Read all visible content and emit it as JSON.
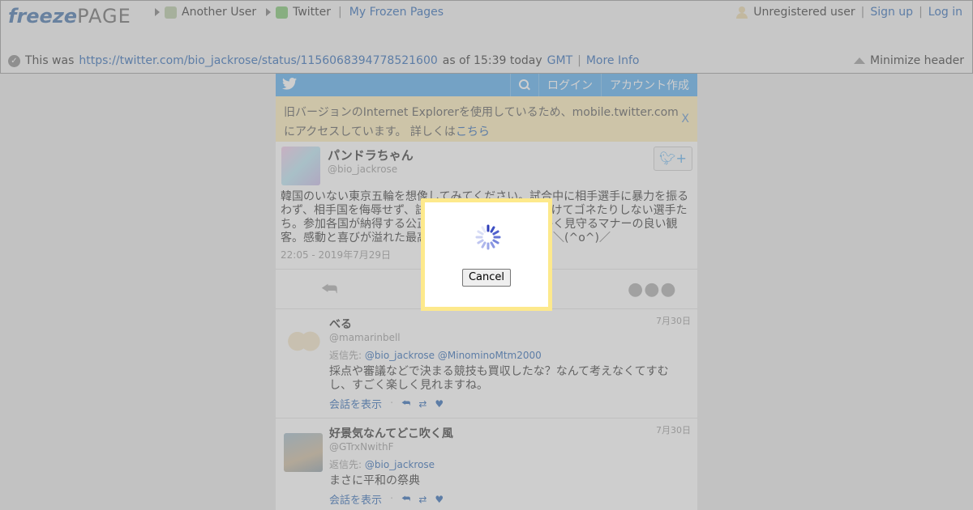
{
  "fp_header": {
    "logo_part1": "freeze",
    "logo_part2": "PAGE",
    "breadcrumb": {
      "user": "Another User",
      "site": "Twitter",
      "separator": "|",
      "my_pages": "My Frozen Pages"
    },
    "account": {
      "status": "Unregistered user",
      "sep1": "|",
      "signup": "Sign up",
      "sep2": "|",
      "login": "Log in"
    },
    "info": {
      "prefix": "This was",
      "url": "https://twitter.com/bio_jackrose/status/1156068394778521600",
      "as_of": "as of 15:39 today",
      "timezone": "GMT",
      "separator": "|",
      "more_info": "More Info"
    },
    "minimize": "Minimize header"
  },
  "twitter": {
    "nav": {
      "login": "ログイン",
      "signup": "アカウント作成"
    },
    "notice": {
      "line1": "旧バージョンのInternet Explorerを使用しているため、mobile.twitter.com",
      "line2": "にアクセスしています。 詳しくは",
      "link": "こちら",
      "close": "X"
    },
    "tweet": {
      "display_name": "パンドラちゃん",
      "handle": "@bio_jackrose",
      "text_lines": [
        "韓国のいない東京五輪を想像してみてください。試合中に相手選手に暴力を振る",
        "わず、相手国を侮辱せず、試合結果について難癖をつけてゴネたりしない選手た",
        "ち。参加各国が納得する公正な審判。観客席から温かく見守るマナーの良い観",
        "客。感動と喜びが溢れた最高の五輪になると思います＼(^o^)／"
      ],
      "timestamp": "22:05 - 2019年7月29日"
    },
    "replies": [
      {
        "name": "べる",
        "handle": "@mamarinbell",
        "date": "7月30日",
        "reply_to_label": "返信先:",
        "reply_to_1": "@bio_jackrose",
        "reply_to_2": "@MinominoMtm2000",
        "text_line1": "採点や審議などで決まる競技も買収したな？なんて考えなくてすむ",
        "text_line2": "し、すごく楽しく見れますね。",
        "show_conversation": "会話を表示"
      },
      {
        "name": "好景気なんてどこ吹く風",
        "handle": "@GTrxNwithF",
        "date": "7月30日",
        "reply_to_label": "返信先:",
        "reply_to_1": "@bio_jackrose",
        "text_line1": "まさに平和の祭典",
        "show_conversation": "会話を表示"
      }
    ]
  },
  "dialog": {
    "cancel": "Cancel"
  },
  "colors": {
    "twitter_blue": "#55acee",
    "notice_bg": "#fdedb8",
    "dialog_border": "#fde98c",
    "link": "#2a66b3"
  }
}
